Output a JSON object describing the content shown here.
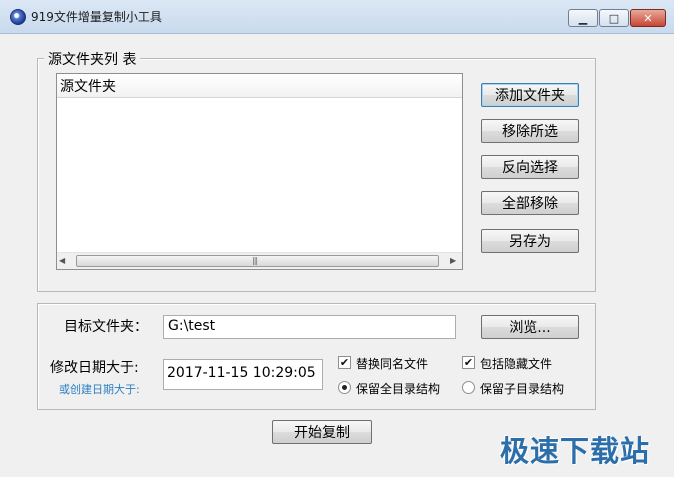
{
  "window": {
    "title": "919文件增量复制小工具",
    "minimize_glyph": "▁",
    "maximize_glyph": "□",
    "close_glyph": "✕",
    "icon": "app-icon"
  },
  "source": {
    "legend": "源文件夹列 表",
    "list_header": "源文件夹",
    "scroll_left": "◀",
    "scroll_right": "▶",
    "thumb_grip": "|||",
    "buttons": {
      "add": "添加文件夹",
      "remove_selected": "移除所选",
      "reverse_select": "反向选择",
      "remove_all": "全部移除",
      "save_as": "另存为"
    }
  },
  "target": {
    "label": "目标文件夹：",
    "value": "G:\\test",
    "browse": "浏览..."
  },
  "date": {
    "label": "修改日期大于:",
    "sublabel": "或创建日期大于:",
    "value": "2017-11-15 10:29:05"
  },
  "options": {
    "replace_same_name": {
      "label": "替换同名文件",
      "checked": true,
      "mark": "✔"
    },
    "include_hidden": {
      "label": "包括隐藏文件",
      "checked": true,
      "mark": "✔"
    },
    "keep_full_structure": {
      "label": "保留全目录结构",
      "selected": true
    },
    "keep_sub_structure": {
      "label": "保留子目录结构",
      "selected": false
    }
  },
  "start_button": "开始复制",
  "watermark": "极速下载站",
  "colors": {
    "accent_link": "#2c7fc3",
    "watermark": "#2b6ea9",
    "close_button": "#c74634"
  }
}
